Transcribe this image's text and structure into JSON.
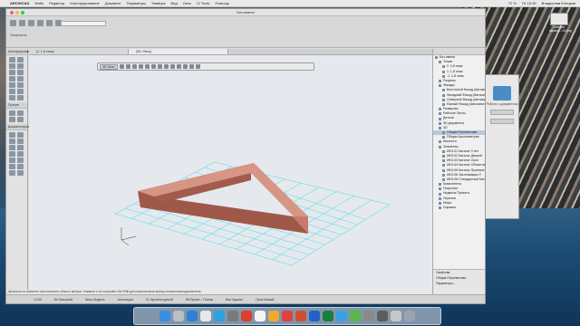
{
  "menubar": {
    "app": "ARCHICAD",
    "items": [
      "Файл",
      "Редактор",
      "Конструирование",
      "Документ",
      "Параметры",
      "Тимворк",
      "Вид",
      "Окно",
      "CI Tools",
      "Помощь"
    ],
    "right": [
      "72 %",
      "Пт 15:30",
      "Владислав Елецкая"
    ]
  },
  "window": {
    "title": "Без имени",
    "tabs": [
      "[1. 1-й этаж]",
      "[3D / Весь]"
    ]
  },
  "toolbox": {
    "title": "Указатель",
    "section_constructive": "Конструирование",
    "section_docs": "Документирование",
    "section_more": "Прочие"
  },
  "pet": {
    "mode": "3D Окно"
  },
  "navigator": {
    "rows": [
      "Без имени",
      "Этажи",
      "2. 2-й этаж",
      "1. 1-й этаж",
      "-1. 1-й этаж",
      "Разрезы",
      "Фасады",
      "Восточный Фасад (Автоматическ",
      "Западный Фасад (Автоматическ",
      "Северный Фасад (Автоматическ",
      "Южный Фасад (Автоматическ",
      "Развертки",
      "Рабочие Листы",
      "Детали",
      "3D документы",
      "3D",
      "Общая Перспектива",
      "Общая Аксонометрия",
      "Каталоги",
      "Элементы",
      "ИКЭ-01 Каталог Стен",
      "ИКЭ-02 Каталог Дверей",
      "ИКЭ-03 Каталог Окон",
      "ИКЭ-04 Каталог Объектов",
      "ИКЭ-05 Каталог Проемов",
      "ИКЭ-06 Экспликация Л",
      "ИКЭ-06 Стандартный Катал",
      "Компоненты",
      "Покрытия",
      "Индексы Проекта",
      "Перечни",
      "Инфо",
      "Справка"
    ],
    "selected": "Общая Перспектива",
    "bottom": [
      "Свойства",
      "Общая Перспектива",
      "Параметры..."
    ]
  },
  "status": {
    "hint": "Щелкните на элементе или начертите область выбора. Нажмите и не отпускайте Alt+Shift для переключения выбора элементов/подэлементов.",
    "items": [
      "1:100",
      "Не Масштаб",
      "Весь Модель",
      "Аннотации",
      "01 Архитектурный",
      "08 Проект - Планы",
      "Все Здание",
      "Простейший"
    ]
  },
  "desktop": {
    "file_label": "Снимок экрана...19.png"
  },
  "sidewin": {
    "title": "Работа с документом"
  }
}
